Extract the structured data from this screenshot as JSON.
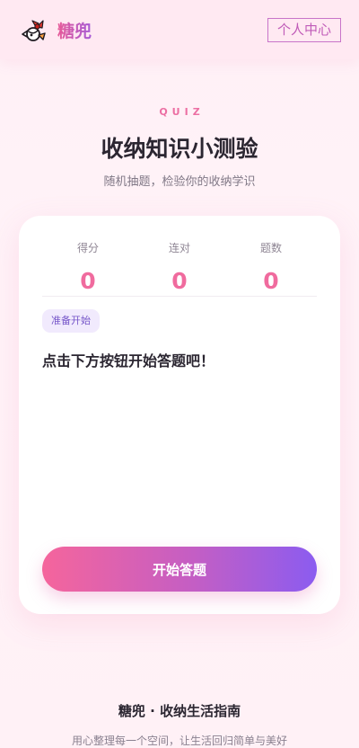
{
  "header": {
    "brand": "糖兜",
    "profile_label": "个人中心",
    "logo_icon": "candy-icon"
  },
  "hero": {
    "kicker": "QUIZ",
    "title": "收纳知识小测验",
    "subtitle": "随机抽题，检验你的收纳学识"
  },
  "quiz": {
    "stats": [
      {
        "label": "得分",
        "value": "0"
      },
      {
        "label": "连对",
        "value": "0"
      },
      {
        "label": "题数",
        "value": "0"
      }
    ],
    "state_badge": "准备开始",
    "prompt": "点击下方按钮开始答题吧！",
    "start_button": "开始答题"
  },
  "footer": {
    "title": "糖兜 · 收纳生活指南",
    "subtitle": "用心整理每一个空间，让生活回归简单与美好"
  },
  "colors": {
    "accent_pink": "#f06b9e",
    "accent_purple": "#8b5cf0",
    "badge_text": "#7656c9"
  }
}
